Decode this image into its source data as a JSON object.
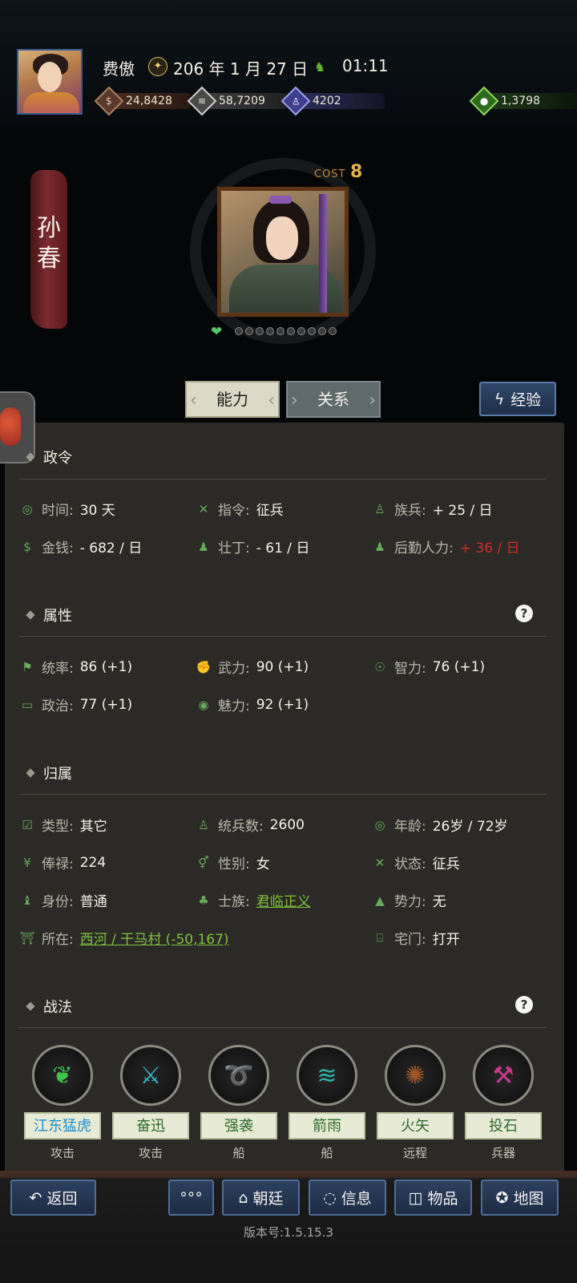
{
  "header": {
    "player_name": "费傲",
    "date": "206 年 1 月 27 日",
    "time": "01:11",
    "resources": {
      "gold": "24,8428",
      "grain": "58,7209",
      "men": "4202",
      "items": "1,3798"
    }
  },
  "general": {
    "name_line1": "孙",
    "name_line2": "春",
    "cost_label": "COST",
    "cost_value": "8",
    "loyalty_dots": 10
  },
  "tabs": {
    "ability": "能力",
    "relation": "关系",
    "experience": "经验"
  },
  "sections": {
    "orders": {
      "title": "政令",
      "time_label": "时间:",
      "time_value": "30 天",
      "command_label": "指令:",
      "command_value": "征兵",
      "clan_label": "族兵:",
      "clan_value": "+ 25 / 日",
      "money_label": "金钱:",
      "money_value": "- 682 / 日",
      "labor_label": "壮丁:",
      "labor_value": "- 61 / 日",
      "logistics_label": "后勤人力:",
      "logistics_value": "+ 36 / 日"
    },
    "attributes": {
      "title": "属性",
      "lead_label": "统率:",
      "lead_value": "86 (+1)",
      "war_label": "武力:",
      "war_value": "90 (+1)",
      "int_label": "智力:",
      "int_value": "76 (+1)",
      "pol_label": "政治:",
      "pol_value": "77 (+1)",
      "cha_label": "魅力:",
      "cha_value": "92 (+1)"
    },
    "affiliation": {
      "title": "归属",
      "type_label": "类型:",
      "type_value": "其它",
      "troops_label": "统兵数:",
      "troops_value": "2600",
      "age_label": "年龄:",
      "age_value": "26岁 / 72岁",
      "salary_label": "俸禄:",
      "salary_value": "224",
      "gender_label": "性别:",
      "gender_value": "女",
      "status_label": "状态:",
      "status_value": "征兵",
      "identity_label": "身份:",
      "identity_value": "普通",
      "gentry_label": "士族:",
      "gentry_value": "君临正义",
      "faction_label": "势力:",
      "faction_value": "无",
      "location_label": "所在:",
      "location_value": "西河 / 干马村 (-50,167)",
      "house_label": "宅门:",
      "house_value": "打开"
    },
    "tactics": {
      "title": "战法",
      "skills": [
        {
          "name": "江东猛虎",
          "type": "攻击",
          "icon": "green-flame-icon",
          "color": "#3ec24a"
        },
        {
          "name": "奋迅",
          "type": "攻击",
          "icon": "crossed-swords-icon",
          "color": "#3ab3c9"
        },
        {
          "name": "强袭",
          "type": "船",
          "icon": "raid-icon",
          "color": "#d0368e"
        },
        {
          "name": "箭雨",
          "type": "船",
          "icon": "arrow-rain-icon",
          "color": "#2fb0a8"
        },
        {
          "name": "火矢",
          "type": "远程",
          "icon": "fire-arrow-icon",
          "color": "#a0562a"
        },
        {
          "name": "投石",
          "type": "兵器",
          "icon": "catapult-icon",
          "color": "#c23a8a"
        }
      ]
    }
  },
  "bottom": {
    "back": "返回",
    "more": "°°°",
    "court": "朝廷",
    "info": "信息",
    "items": "物品",
    "map": "地图",
    "version": "版本号:1.5.15.3"
  }
}
